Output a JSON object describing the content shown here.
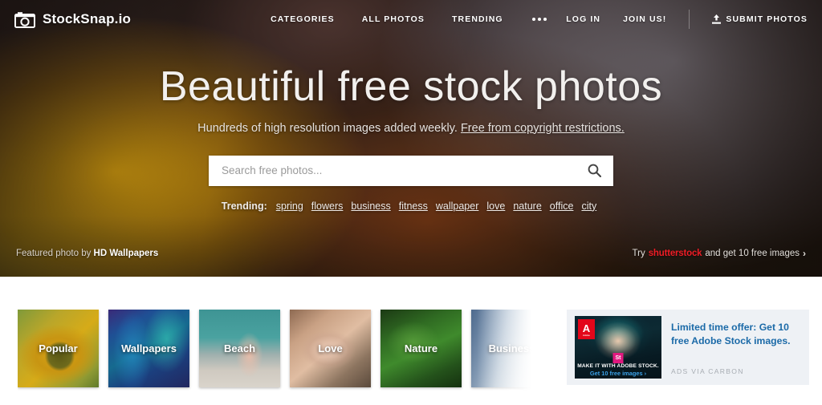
{
  "brand": {
    "name": "StockSnap.io",
    "icon": "camera-icon"
  },
  "nav": {
    "center": [
      {
        "label": "CATEGORIES",
        "name": "categories"
      },
      {
        "label": "ALL PHOTOS",
        "name": "all-photos"
      },
      {
        "label": "TRENDING",
        "name": "trending"
      }
    ],
    "more_icon": "ellipsis-icon",
    "right": [
      {
        "label": "LOG IN",
        "name": "log-in"
      },
      {
        "label": "JOIN US!",
        "name": "join-us"
      }
    ],
    "submit": {
      "label": "SUBMIT PHOTOS",
      "icon": "upload-icon"
    }
  },
  "hero": {
    "title": "Beautiful free stock photos",
    "subtitle_text": "Hundreds of high resolution images added weekly. ",
    "subtitle_link": "Free from copyright restrictions.",
    "search": {
      "placeholder": "Search free photos...",
      "value": "",
      "icon": "search-icon"
    },
    "trending_label": "Trending:",
    "trending_tags": [
      "spring",
      "flowers",
      "business",
      "fitness",
      "wallpaper",
      "love",
      "nature",
      "office",
      "city"
    ],
    "featured_prefix": "Featured photo by ",
    "featured_author": "HD Wallpapers",
    "promo": {
      "prefix": "Try ",
      "brand": "shutterstock",
      "suffix": " and get 10 free images",
      "chevron": "›",
      "brand_color": "#ee1c25"
    }
  },
  "categories": [
    {
      "label": "Popular",
      "art": "art-popular"
    },
    {
      "label": "Wallpapers",
      "art": "art-wallpapers"
    },
    {
      "label": "Beach",
      "art": "art-beach"
    },
    {
      "label": "Love",
      "art": "art-love"
    },
    {
      "label": "Nature",
      "art": "art-nature"
    },
    {
      "label": "Business",
      "art": "art-business"
    }
  ],
  "ad": {
    "headline": "Limited time offer: Get 10 free Adobe Stock images.",
    "via": "Ads via Carbon",
    "creative": {
      "logo_text": "A",
      "logo_sub": "Adobe",
      "badge": "St",
      "caption": "MAKE IT WITH ADOBE STOCK.",
      "cta": "Get 10 free images ›"
    }
  }
}
